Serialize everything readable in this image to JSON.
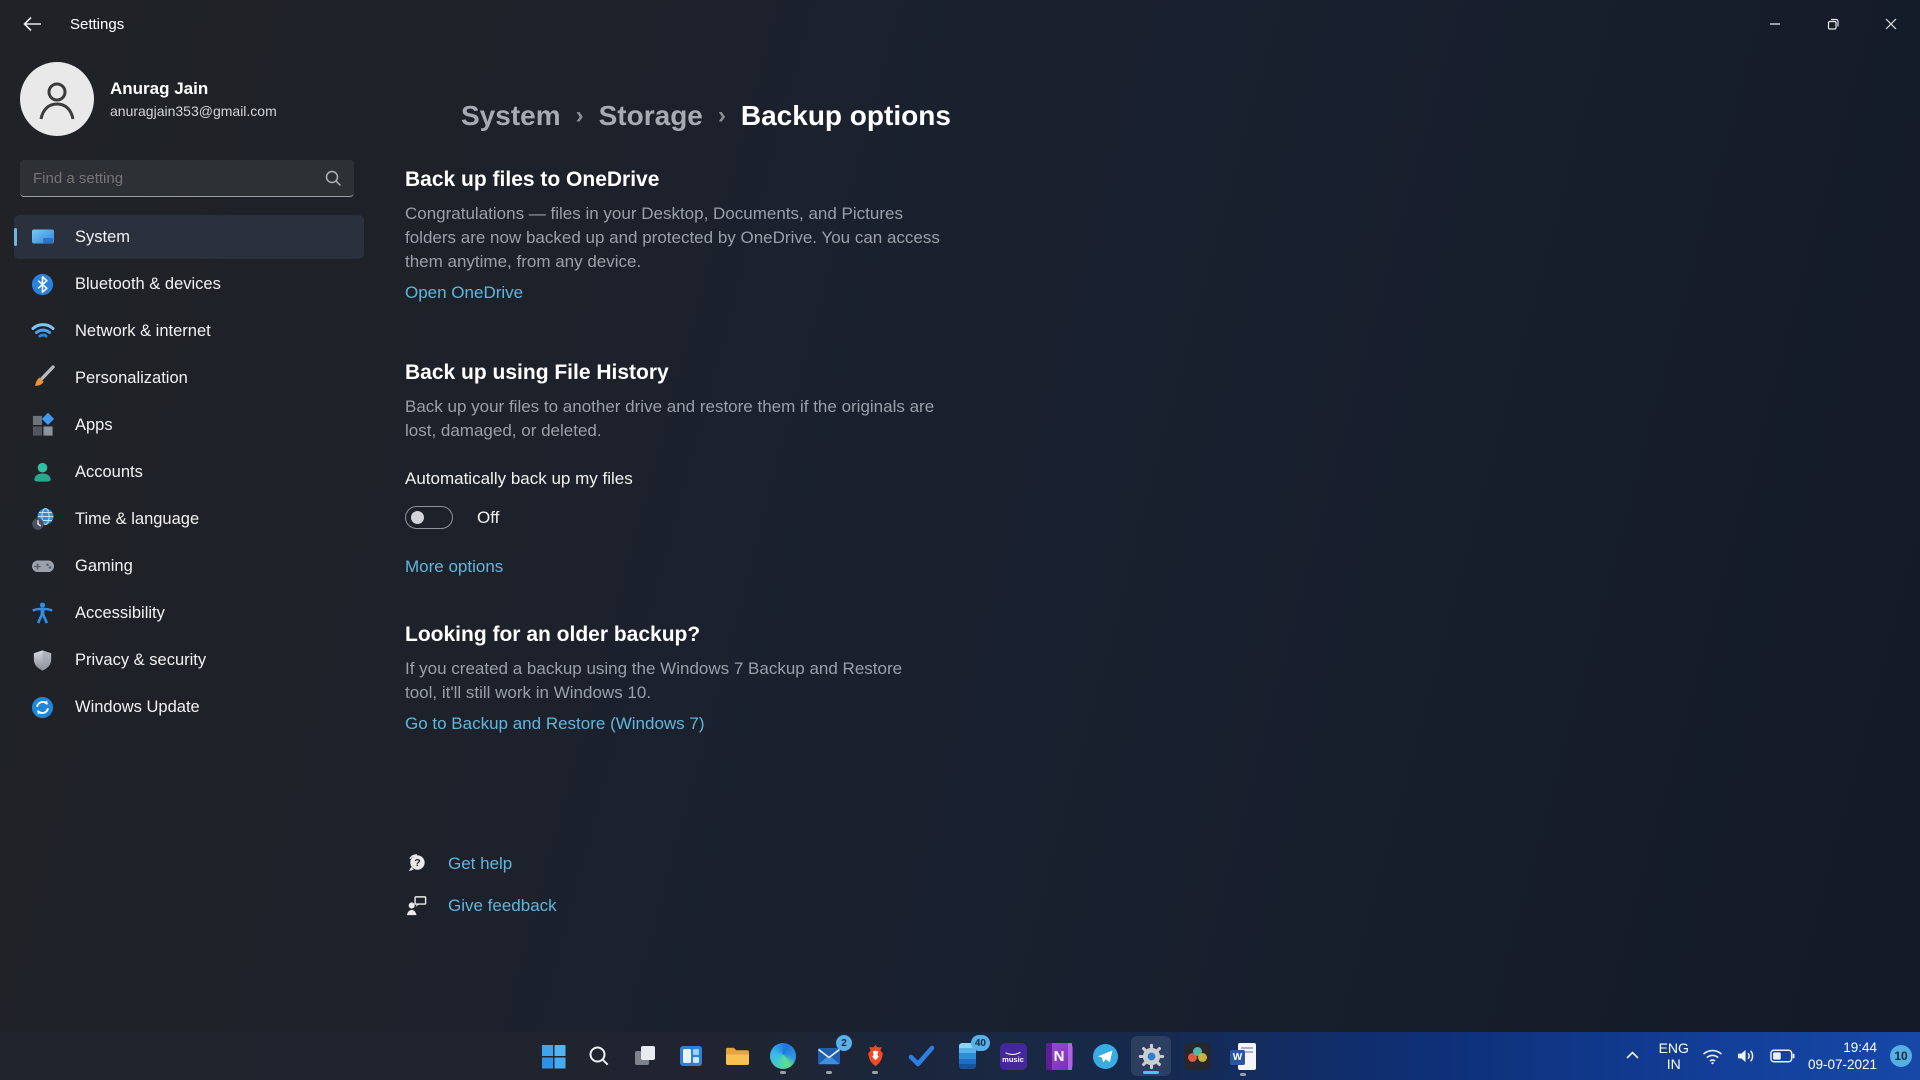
{
  "window": {
    "title": "Settings"
  },
  "profile": {
    "name": "Anurag Jain",
    "email": "anuragjain353@gmail.com"
  },
  "search": {
    "placeholder": "Find a setting"
  },
  "sidebar": {
    "items": [
      {
        "label": "System",
        "icon": "system-icon",
        "selected": true
      },
      {
        "label": "Bluetooth & devices",
        "icon": "bluetooth-icon"
      },
      {
        "label": "Network & internet",
        "icon": "network-icon"
      },
      {
        "label": "Personalization",
        "icon": "personalization-icon"
      },
      {
        "label": "Apps",
        "icon": "apps-icon"
      },
      {
        "label": "Accounts",
        "icon": "accounts-icon"
      },
      {
        "label": "Time & language",
        "icon": "time-language-icon"
      },
      {
        "label": "Gaming",
        "icon": "gaming-icon"
      },
      {
        "label": "Accessibility",
        "icon": "accessibility-icon"
      },
      {
        "label": "Privacy & security",
        "icon": "privacy-security-icon"
      },
      {
        "label": "Windows Update",
        "icon": "windows-update-icon"
      }
    ]
  },
  "breadcrumb": {
    "root": "System",
    "middle": "Storage",
    "current": "Backup options",
    "separator": "›"
  },
  "content": {
    "onedrive": {
      "title": "Back up files to OneDrive",
      "body": "Congratulations — files in your Desktop, Documents, and Pictures folders are now backed up and protected by OneDrive. You can access them anytime, from any device.",
      "link": "Open OneDrive"
    },
    "file_history": {
      "title": "Back up using File History",
      "body": "Back up your files to another drive and restore them if the originals are lost, damaged, or deleted.",
      "toggle_label": "Automatically back up my files",
      "toggle_state": "Off",
      "link": "More options"
    },
    "older_backup": {
      "title": "Looking for an older backup?",
      "body": "If you created a backup using the Windows 7 Backup and Restore tool, it'll still work in Windows 10.",
      "link": "Go to Backup and Restore (Windows 7)"
    },
    "get_help": "Get help",
    "give_feedback": "Give feedback"
  },
  "taskbar": {
    "icons": [
      "start",
      "search",
      "task-view",
      "widgets",
      "file-explorer",
      "edge",
      "mail",
      "brave",
      "todo",
      "app-40",
      "amazon-music",
      "onenote",
      "telegram",
      "settings",
      "davinci-resolve",
      "word"
    ],
    "badges": {
      "mail": "2",
      "app": "40",
      "notifications": "10"
    },
    "glyphs": {
      "amazon_music": "music",
      "onenote": "N",
      "word": "W"
    },
    "tray": {
      "language": "ENG",
      "region": "IN",
      "time": "19:44",
      "date": "09-07-2021"
    }
  },
  "colors": {
    "accent": "#4cc2ff",
    "link": "#62b6de",
    "selected_pill": "#6cb5e8"
  }
}
